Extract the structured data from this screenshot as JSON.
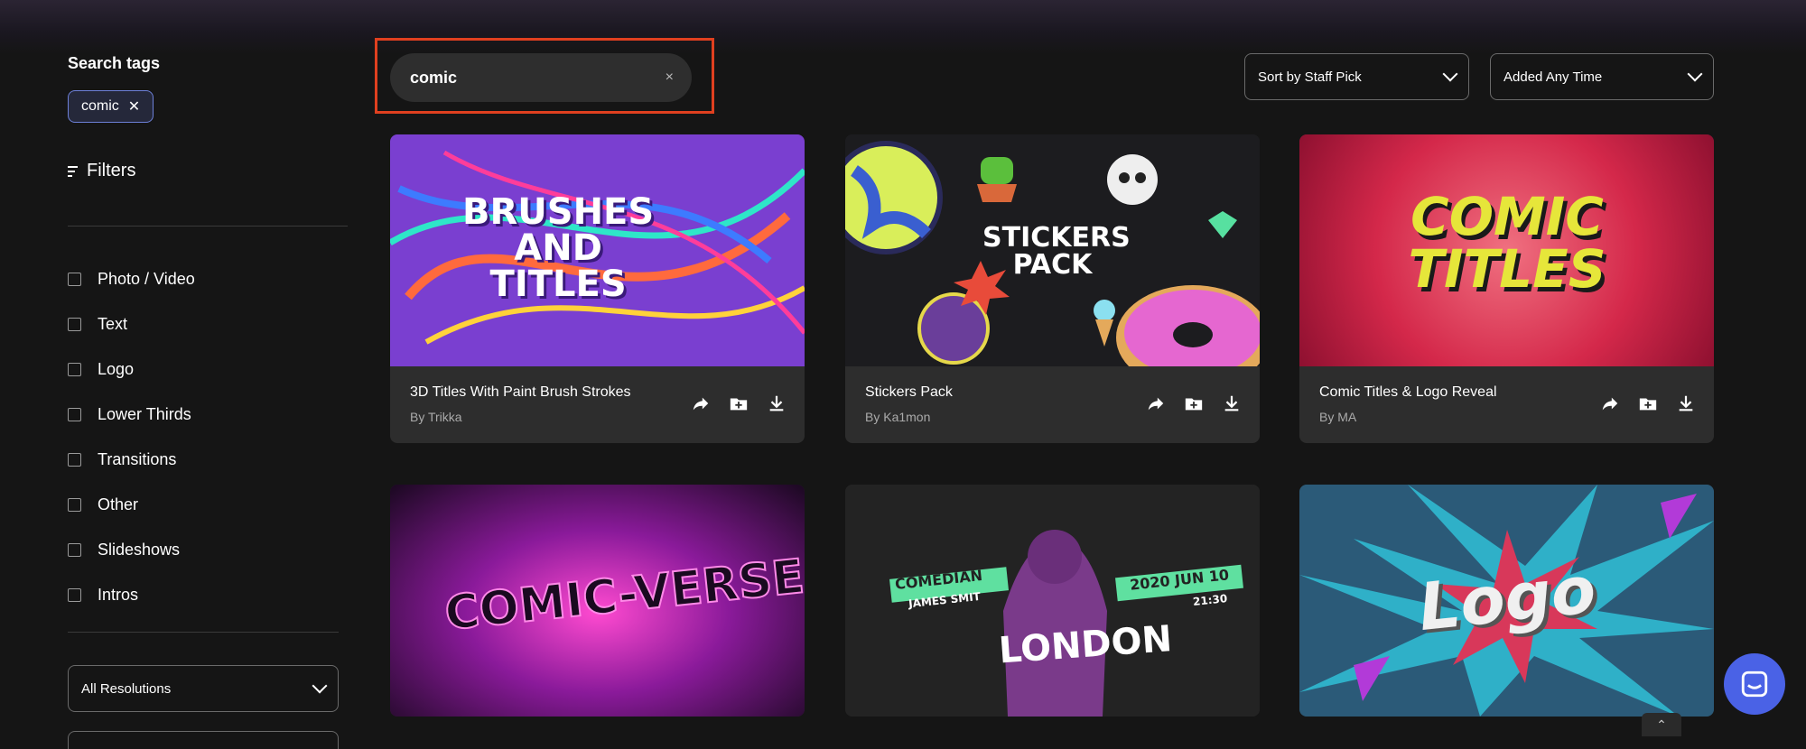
{
  "sidebar": {
    "title": "Search tags",
    "tag": "comic",
    "tag_remove": "✕",
    "filters_label": "Filters",
    "categories": [
      "Photo / Video",
      "Text",
      "Logo",
      "Lower Thirds",
      "Transitions",
      "Other",
      "Slideshows",
      "Intros"
    ],
    "resolution_select": "All Resolutions"
  },
  "search": {
    "value": "comic",
    "clear": "×"
  },
  "sort": {
    "sort_by": "Sort by Staff Pick",
    "date_filter": "Added Any Time"
  },
  "cards": [
    {
      "title": "3D Titles With Paint Brush Strokes",
      "author": "By Trikka",
      "thumb_text": [
        "BRUSHES",
        "AND",
        "TITLES"
      ]
    },
    {
      "title": "Stickers Pack",
      "author": "By Ka1mon",
      "thumb_text": [
        "STICKERS",
        "PACK"
      ]
    },
    {
      "title": "Comic Titles & Logo Reveal",
      "author": "By MA",
      "thumb_text": [
        "COMIC",
        "TITLES"
      ]
    },
    {
      "title": "",
      "author": "",
      "thumb_text": [
        "COMIC-VERSE"
      ]
    },
    {
      "title": "",
      "author": "",
      "thumb_text": [
        "COMEDIAN",
        "JAMES SMIT",
        "2020 JUN 10",
        "21:30",
        "LONDON"
      ]
    },
    {
      "title": "",
      "author": "",
      "thumb_text": [
        "Logo"
      ]
    }
  ],
  "colors": {
    "accent": "#e0401f",
    "chip_border": "#6d80d8",
    "intercom": "#4a62e6"
  },
  "icons": [
    "share-icon",
    "add-to-folder-icon",
    "download-icon",
    "chevron-down-icon",
    "filters-icon",
    "chat-icon",
    "chevron-up-icon"
  ],
  "scroll_top_glyph": "⌃"
}
